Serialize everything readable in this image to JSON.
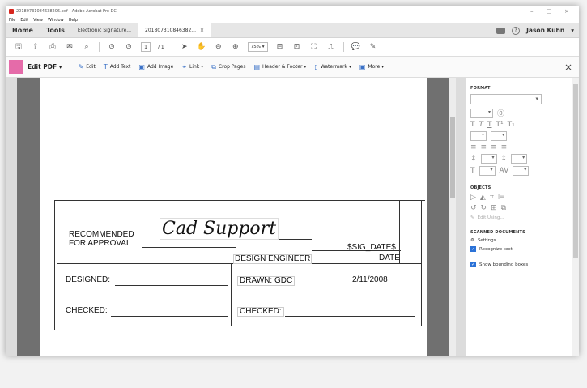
{
  "window": {
    "title": "20180731084638206.pdf - Adobe Acrobat Pro DC",
    "controls": [
      "–",
      "□",
      "×"
    ]
  },
  "menu": [
    "File",
    "Edit",
    "View",
    "Window",
    "Help"
  ],
  "tabs": {
    "home": "Home",
    "tools": "Tools",
    "esig": "Electronic Signature...",
    "doc": "201807310846382...",
    "close": "×",
    "user": "Jason Kuhn",
    "user_chevron": "▾",
    "help": "?"
  },
  "toolbar": {
    "page_current": "1",
    "page_total": "/ 1",
    "zoom": "75%",
    "zoom_chevron": "▾"
  },
  "editbar": {
    "title": "Edit PDF",
    "title_chevron": "▾",
    "items": [
      {
        "icon": "edit-icon",
        "glyph": "✎",
        "label": "Edit"
      },
      {
        "icon": "text-icon",
        "glyph": "T",
        "label": "Add Text"
      },
      {
        "icon": "image-icon",
        "glyph": "▣",
        "label": "Add Image"
      },
      {
        "icon": "link-icon",
        "glyph": "⚭",
        "label": "Link ▾"
      },
      {
        "icon": "crop-icon",
        "glyph": "⧉",
        "label": "Crop Pages"
      },
      {
        "icon": "header-footer-icon",
        "glyph": "▤",
        "label": "Header & Footer ▾"
      },
      {
        "icon": "watermark-icon",
        "glyph": "▯",
        "label": "Watermark ▾"
      },
      {
        "icon": "more-icon",
        "glyph": "▣",
        "label": "More ▾"
      }
    ],
    "close": "×"
  },
  "panel": {
    "format_heading": "FORMAT",
    "objects_heading": "OBJECTS",
    "edit_using": "Edit Using...",
    "scanned_heading": "SCANNED DOCUMENTS",
    "settings": "Settings",
    "recognize_text": "Recognize text",
    "show_bounding": "Show bounding boxes"
  },
  "form": {
    "recommended": "RECOMMENDED",
    "for_approval": "FOR APPROVAL",
    "signature": "Cad Support",
    "sig_date": "$SIG_DATE$",
    "design_engineer": "DESIGN ENGINEER",
    "date": "DATE",
    "designed": "DESIGNED:",
    "drawn": "DRAWN: GDC",
    "drawn_date": "2/11/2008",
    "checked_left": "CHECKED:",
    "checked_right": "CHECKED:"
  },
  "colors": {
    "accent_pink": "#e56ba9",
    "checkbox_blue": "#2b72d7",
    "pdf_red": "#d7261e"
  }
}
